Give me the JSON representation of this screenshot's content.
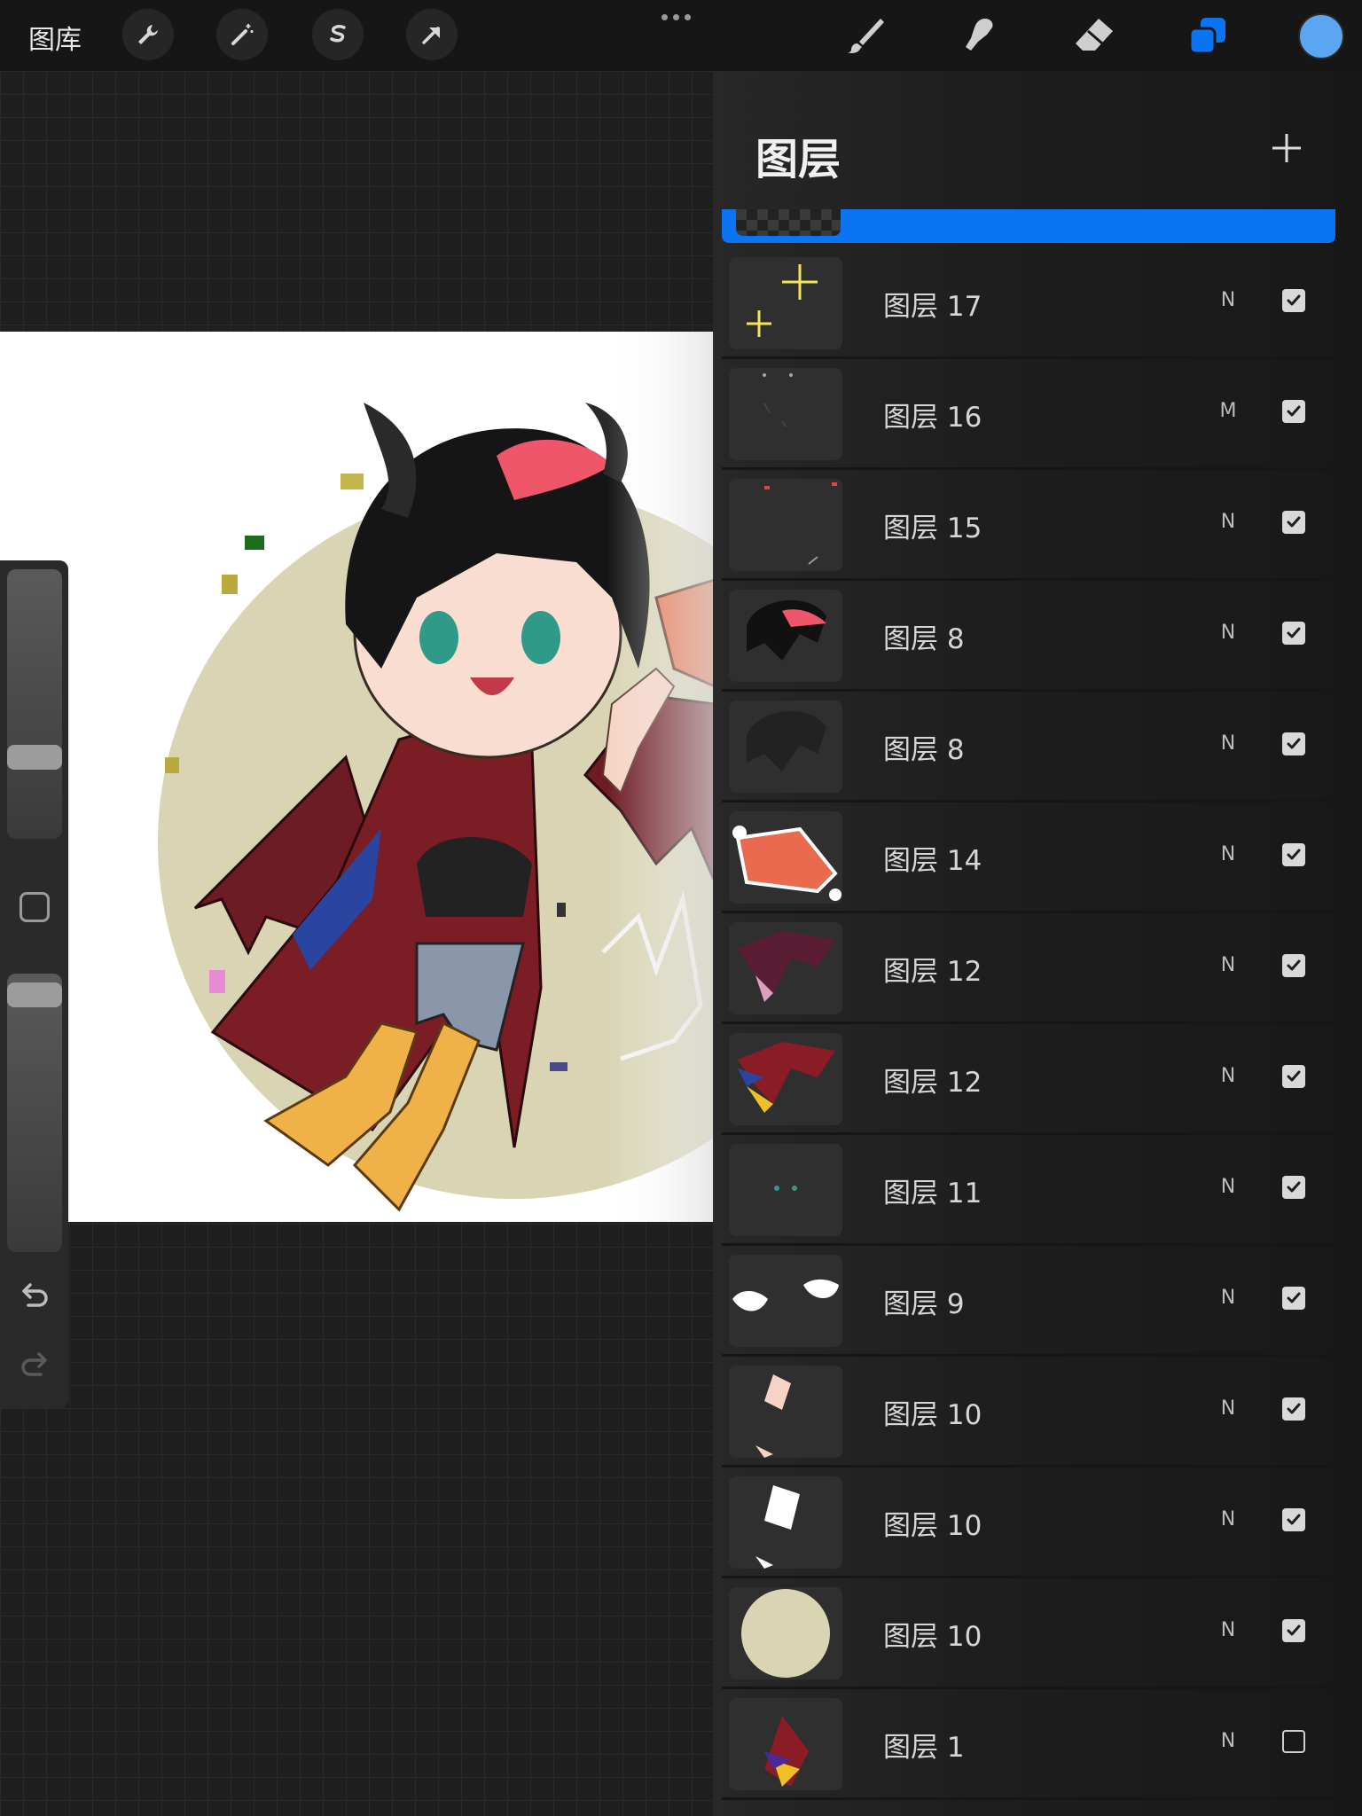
{
  "toolbar": {
    "gallery_label": "图库",
    "left_tools": [
      "wrench-icon",
      "magic-wand-icon",
      "selection-icon",
      "transform-arrow-icon"
    ],
    "right_tools": [
      "brush-icon",
      "smudge-icon",
      "eraser-icon",
      "layers-icon"
    ],
    "active_tool": "layers-icon",
    "accent_color": "#0a74f2",
    "current_color": "#5aa6f0"
  },
  "layers_panel": {
    "title": "图层",
    "add_icon": "plus-icon",
    "layers": [
      {
        "name": "图层 17",
        "mode": "N",
        "visible": true
      },
      {
        "name": "图层 16",
        "mode": "M",
        "visible": true
      },
      {
        "name": "图层 15",
        "mode": "N",
        "visible": true
      },
      {
        "name": "图层 8",
        "mode": "N",
        "visible": true
      },
      {
        "name": "图层 8",
        "mode": "N",
        "visible": true
      },
      {
        "name": "图层 14",
        "mode": "N",
        "visible": true
      },
      {
        "name": "图层 12",
        "mode": "N",
        "visible": true
      },
      {
        "name": "图层 12",
        "mode": "N",
        "visible": true
      },
      {
        "name": "图层 11",
        "mode": "N",
        "visible": true
      },
      {
        "name": "图层 9",
        "mode": "N",
        "visible": true
      },
      {
        "name": "图层 10",
        "mode": "N",
        "visible": true
      },
      {
        "name": "图层 10",
        "mode": "N",
        "visible": true
      },
      {
        "name": "图层 10",
        "mode": "N",
        "visible": true
      },
      {
        "name": "图层 1",
        "mode": "N",
        "visible": false
      }
    ]
  },
  "sidebar": {
    "brush_size_level": 0.68,
    "opacity_level": 0.97,
    "icons": [
      "modify-square-icon",
      "undo-icon",
      "redo-icon"
    ]
  }
}
